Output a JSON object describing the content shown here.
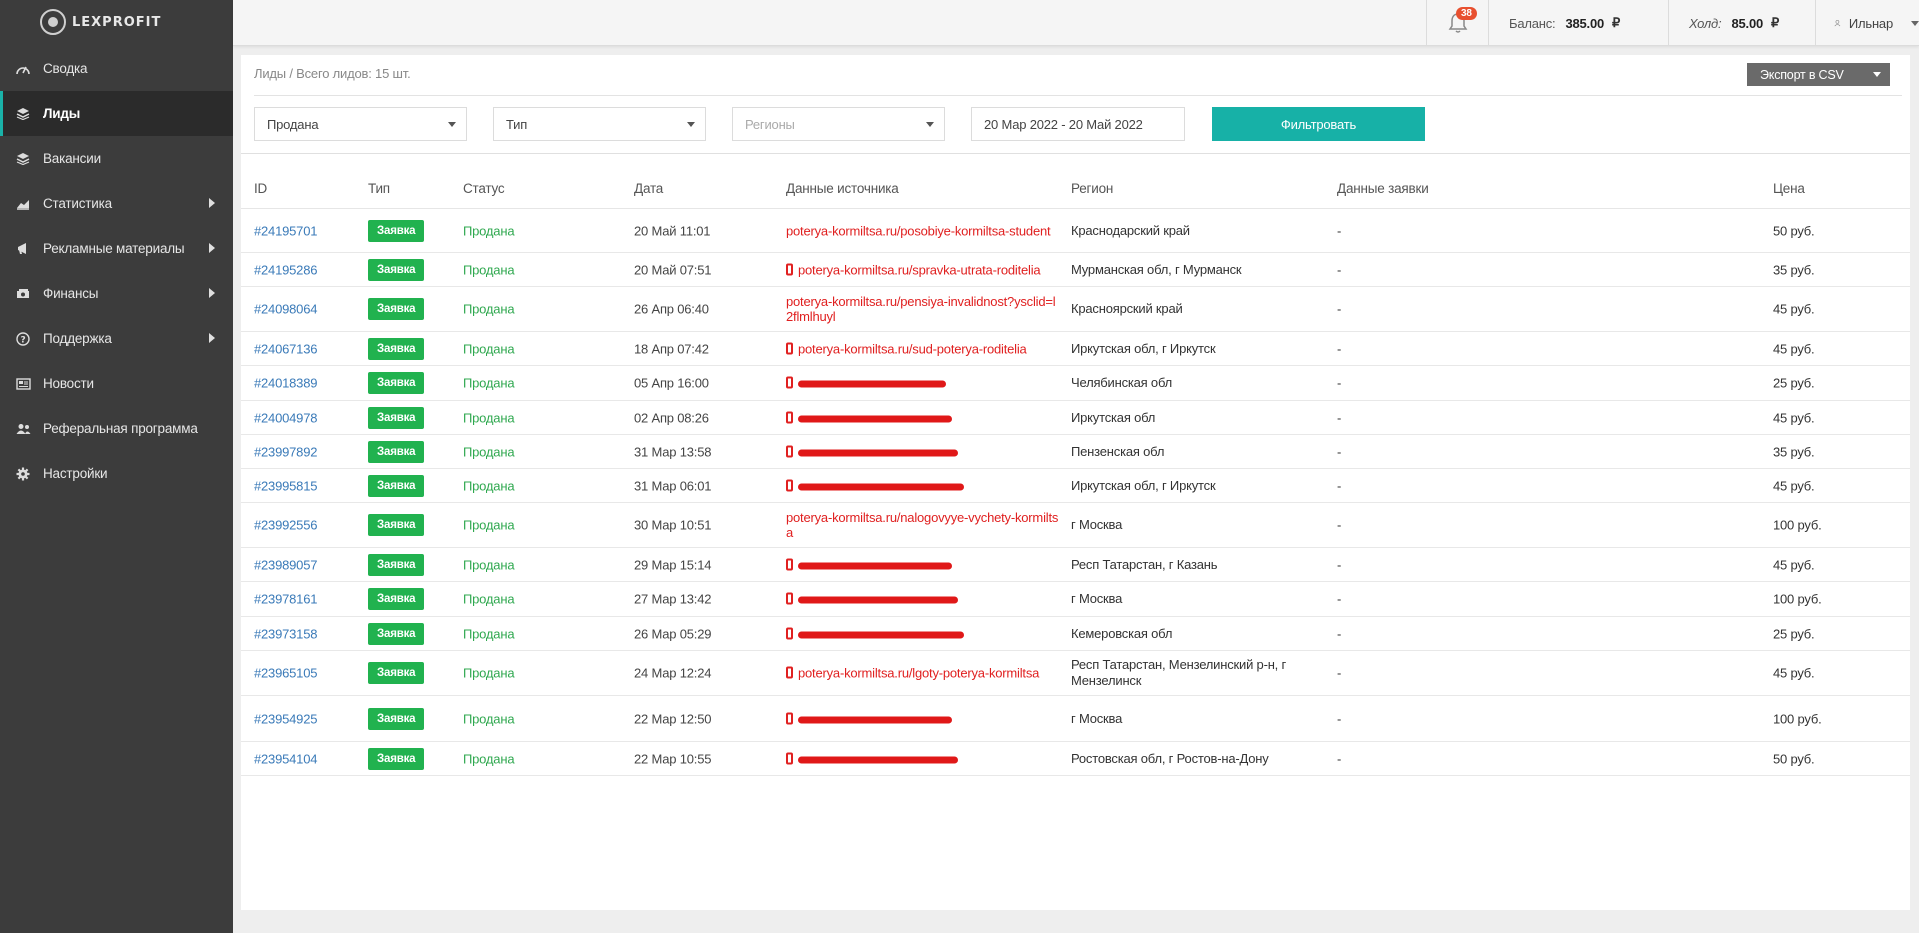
{
  "brand": {
    "name": "LEXPROFIT"
  },
  "sidebar": {
    "items": [
      {
        "label": "Сводка",
        "icon": "dashboard-icon"
      },
      {
        "label": "Лиды",
        "icon": "layers-icon",
        "active": true
      },
      {
        "label": "Вакансии",
        "icon": "layers-icon"
      },
      {
        "label": "Статистика",
        "icon": "chart-icon",
        "submenu": true
      },
      {
        "label": "Рекламные материалы",
        "icon": "megaphone-icon",
        "submenu": true
      },
      {
        "label": "Финансы",
        "icon": "money-icon",
        "submenu": true
      },
      {
        "label": "Поддержка",
        "icon": "question-icon",
        "submenu": true
      },
      {
        "label": "Новости",
        "icon": "newspaper-icon"
      },
      {
        "label": "Реферальная программа",
        "icon": "users-icon"
      },
      {
        "label": "Настройки",
        "icon": "gear-icon"
      }
    ]
  },
  "topbar": {
    "notifications": "38",
    "balance_label": "Баланс:",
    "balance_value": "385.00",
    "hold_label": "Холд:",
    "hold_value": "85.00",
    "currency": "₽",
    "user": "Ильнар"
  },
  "page": {
    "breadcrumb": "Лиды / Всего лидов: 15 шт.",
    "export_label": "Экспорт в CSV"
  },
  "filters": {
    "status": "Продана",
    "type": "Тип",
    "region_placeholder": "Регионы",
    "date_range": "20 Мар 2022 - 20 Май 2022",
    "submit": "Фильтровать"
  },
  "table": {
    "headers": [
      "ID",
      "Тип",
      "Статус",
      "Дата",
      "Данные источника",
      "Регион",
      "Данные заявки",
      "Цена"
    ],
    "rows": [
      {
        "id": "#24195701",
        "type": "Заявка",
        "status": "Продана",
        "date": "20 Май 11:01",
        "source": "poterya-kormiltsa.ru/posobiye-kormiltsa-student",
        "region": "Краснодарский край",
        "data": "-",
        "price": "50 руб."
      },
      {
        "id": "#24195286",
        "type": "Заявка",
        "status": "Продана",
        "date": "20 Май 07:51",
        "source": "poterya-kormiltsa.ru/spravka-utrata-roditelia",
        "phone": true,
        "region": "Мурманская обл, г Мурманск",
        "data": "-",
        "price": "35 руб."
      },
      {
        "id": "#24098064",
        "type": "Заявка",
        "status": "Продана",
        "date": "26 Апр 06:40",
        "source": "poterya-kormiltsa.ru/pensiya-invalidnost?ysclid=l2flmlhuyl",
        "region": "Красноярский край",
        "data": "-",
        "price": "45 руб."
      },
      {
        "id": "#24067136",
        "type": "Заявка",
        "status": "Продана",
        "date": "18 Апр 07:42",
        "source": "poterya-kormiltsa.ru/sud-poterya-roditelia",
        "phone": true,
        "region": "Иркутская обл, г Иркутск",
        "data": "-",
        "price": "45 руб."
      },
      {
        "id": "#24018389",
        "type": "Заявка",
        "status": "Продана",
        "date": "05 Апр 16:00",
        "source": "",
        "redacted": true,
        "region": "Челябинская обл",
        "data": "-",
        "price": "25 руб."
      },
      {
        "id": "#24004978",
        "type": "Заявка",
        "status": "Продана",
        "date": "02 Апр 08:26",
        "source": "",
        "redacted": true,
        "region": "Иркутская обл",
        "data": "-",
        "price": "45 руб."
      },
      {
        "id": "#23997892",
        "type": "Заявка",
        "status": "Продана",
        "date": "31 Мар 13:58",
        "source": "",
        "redacted": true,
        "region": "Пензенская обл",
        "data": "-",
        "price": "35 руб."
      },
      {
        "id": "#23995815",
        "type": "Заявка",
        "status": "Продана",
        "date": "31 Мар 06:01",
        "source": "",
        "redacted": true,
        "region": "Иркутская обл, г Иркутск",
        "data": "-",
        "price": "45 руб."
      },
      {
        "id": "#23992556",
        "type": "Заявка",
        "status": "Продана",
        "date": "30 Мар 10:51",
        "source": "poterya-kormiltsa.ru/nalogovyye-vychety-kormiltsa",
        "region": "г Москва",
        "data": "-",
        "price": "100 руб."
      },
      {
        "id": "#23989057",
        "type": "Заявка",
        "status": "Продана",
        "date": "29 Мар 15:14",
        "source": "",
        "redacted": true,
        "region": "Респ Татарстан, г Казань",
        "data": "-",
        "price": "45 руб."
      },
      {
        "id": "#23978161",
        "type": "Заявка",
        "status": "Продана",
        "date": "27 Мар 13:42",
        "source": "",
        "redacted": true,
        "region": "г Москва",
        "data": "-",
        "price": "100 руб."
      },
      {
        "id": "#23973158",
        "type": "Заявка",
        "status": "Продана",
        "date": "26 Мар 05:29",
        "source": "",
        "redacted": true,
        "region": "Кемеровская обл",
        "data": "-",
        "price": "25 руб."
      },
      {
        "id": "#23965105",
        "type": "Заявка",
        "status": "Продана",
        "date": "24 Мар 12:24",
        "source": "poterya-kormiltsa.ru/lgoty-poterya-kormiltsa",
        "phone": true,
        "region": "Респ Татарстан, Мензелинский р-н, г Мензелинск",
        "data": "-",
        "price": "45 руб."
      },
      {
        "id": "#23954925",
        "type": "Заявка",
        "status": "Продана",
        "date": "22 Мар 12:50",
        "source": "",
        "redacted": true,
        "region": "г Москва",
        "data": "-",
        "price": "100 руб."
      },
      {
        "id": "#23954104",
        "type": "Заявка",
        "status": "Продана",
        "date": "22 Мар 10:55",
        "source": "",
        "redacted": true,
        "region": "Ростовская обл, г Ростов-на-Дону",
        "data": "-",
        "price": "50 руб."
      }
    ]
  },
  "colors": {
    "sidebar_bg": "#3c3c3c",
    "accent": "#17b1a7",
    "badge": "#21b24f",
    "status": "#2fa84f",
    "link": "#3a7ab8",
    "source": "#e02020"
  }
}
